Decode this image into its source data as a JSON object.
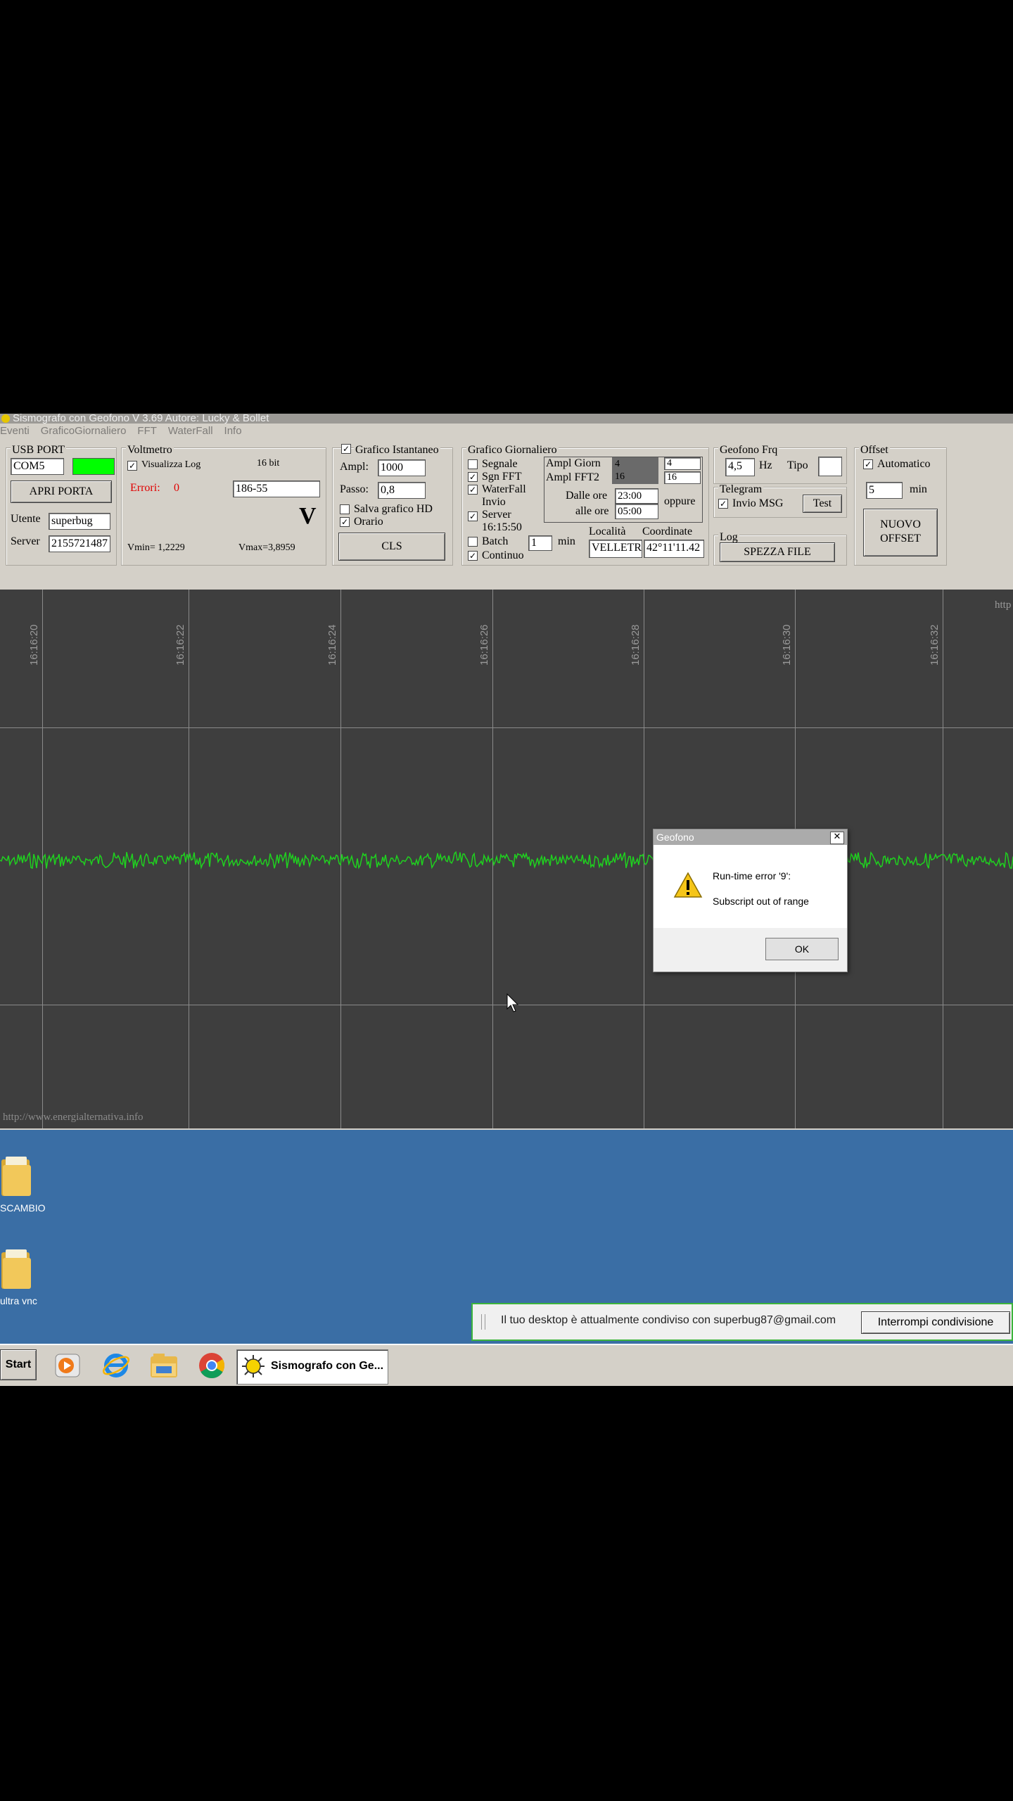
{
  "app": {
    "title": "Sismografo con Geofono V 3.69  Autore: Lucky & Bollet",
    "menu": [
      "Eventi",
      "GraficoGiornaliero",
      "FFT",
      "WaterFall",
      "Info"
    ]
  },
  "usb": {
    "group": "USB PORT",
    "port_value": "COM5",
    "led_color": "#00ff00",
    "open_button": "APRI PORTA",
    "user_label": "Utente",
    "user_value": "superbug",
    "server_label": "Server",
    "server_value": "2155721487"
  },
  "voltmeter": {
    "group": "Voltmetro",
    "log_label": "Visualizza Log",
    "log_checked": true,
    "bits": "16 bit",
    "errors_label": "Errori:",
    "errors_value": "0",
    "field_value": "186-55",
    "unit": "V",
    "vmin": "Vmin=  1,2229",
    "vmax": "Vmax=3,8959"
  },
  "instant": {
    "group": "Grafico Istantaneo",
    "checked": true,
    "ampl_label": "Ampl:",
    "ampl_value": "1000",
    "passo_label": "Passo:",
    "passo_value": "0,8",
    "save_hd_label": "Salva grafico HD",
    "save_hd_checked": false,
    "orario_label": "Orario",
    "orario_checked": true,
    "cls_button": "CLS"
  },
  "daily": {
    "group": "Grafico Giornaliero",
    "segnale_label": "Segnale",
    "segnale_checked": false,
    "sgn_fft_label": "Sgn FFT",
    "sgn_fft_checked": true,
    "waterfall_label": "WaterFall",
    "waterfall_checked": true,
    "invio_label": "Invio",
    "server_label": "Server",
    "server_time": "16:15:50",
    "invio_checked": true,
    "ampl_giorn_label": "Ampl Giorn",
    "ampl_giorn_value": "4",
    "ampl_giorn_value2": "4",
    "ampl_fft2_label": "Ampl FFT2",
    "ampl_fft2_value": "16",
    "ampl_fft2_value2": "16",
    "dalle_label": "Dalle ore",
    "dalle_value": "23:00",
    "alle_label": "alle ore",
    "alle_value": "05:00",
    "oppure": "oppure",
    "batch_label": "Batch",
    "batch_checked": false,
    "batch_value": "1",
    "min_label": "min",
    "continuo_label": "Continuo",
    "continuo_checked": true,
    "localita_label": "Località",
    "localita_value": "VELLETR",
    "coord_label": "Coordinate",
    "coord_value": "42°11'11.42"
  },
  "geofono": {
    "group": "Geofono Frq",
    "freq_value": "4,5",
    "hz": "Hz",
    "tipo_label": "Tipo",
    "tipo_value": ""
  },
  "telegram": {
    "group": "Telegram",
    "invio_label": "Invio MSG",
    "invio_checked": true,
    "test_button": "Test"
  },
  "log": {
    "group": "Log",
    "split_button": "SPEZZA FILE"
  },
  "offset": {
    "group": "Offset",
    "auto_label": "Automatico",
    "auto_checked": true,
    "min_value": "5",
    "min_label": "min",
    "new_button_line1": "NUOVO",
    "new_button_line2": "OFFSET"
  },
  "graph": {
    "background": "#3e3e3e",
    "signal_color": "#1fd11f",
    "times": [
      "16:16:20",
      "16:16:22",
      "16:16:24",
      "16:16:26",
      "16:16:28",
      "16:16:30",
      "16:16:32"
    ],
    "corner_text": "http",
    "watermark": "http://www.energialternativa.info"
  },
  "dialog": {
    "title": "Geofono",
    "line1": "Run-time error '9':",
    "line2": "Subscript out of range",
    "ok": "OK"
  },
  "desktop": {
    "icons": [
      {
        "label": "SCAMBIO"
      },
      {
        "label": "ultra vnc"
      }
    ],
    "share_message": "Il tuo desktop è attualmente condiviso con superbug87@gmail.com",
    "stop_share": "Interrompi condivisione"
  },
  "taskbar": {
    "start": "Start",
    "active_task": "Sismografo con Ge..."
  }
}
